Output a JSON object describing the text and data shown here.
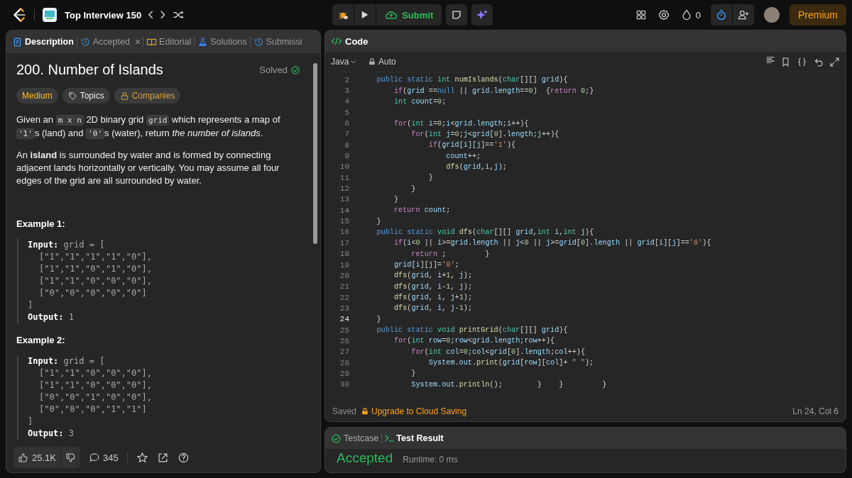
{
  "topbar": {
    "list_title": "Top Interview 150",
    "submit": "Submit",
    "streak": "0",
    "premium": "Premium"
  },
  "description": {
    "tabs": [
      {
        "kind": "doc",
        "label": "Description",
        "selected": true
      },
      {
        "kind": "history",
        "label": "Accepted",
        "selected": false,
        "close": "×"
      },
      {
        "kind": "book",
        "label": "Editorial",
        "selected": false
      },
      {
        "kind": "flask",
        "label": "Solutions",
        "selected": false
      },
      {
        "kind": "history",
        "label": "Submissi",
        "selected": false
      }
    ],
    "title": "200. Number of Islands",
    "status": "Solved",
    "tags": [
      {
        "kind": "difficulty",
        "label": "Medium"
      },
      {
        "kind": "tag",
        "label": "Topics"
      },
      {
        "kind": "lock",
        "label": "Companies"
      }
    ],
    "paragraphs": [
      [
        {
          "kind": "text",
          "text": "Given an "
        },
        {
          "kind": "code",
          "text": "m x n"
        },
        {
          "kind": "text",
          "text": " 2D binary grid "
        },
        {
          "kind": "code",
          "text": "grid"
        },
        {
          "kind": "text",
          "text": " which represents a map of "
        },
        {
          "kind": "code",
          "text": "'1'"
        },
        {
          "kind": "text",
          "text": "s (land) and "
        },
        {
          "kind": "code",
          "text": "'0'"
        },
        {
          "kind": "text",
          "text": "s (water), return *the number of islands*."
        }
      ],
      [
        {
          "kind": "text",
          "text": "An **island** is surrounded by water and is formed by connecting adjacent lands horizontally or vertically. You may assume all four edges of the grid are all surrounded by water."
        }
      ]
    ],
    "examples": [
      {
        "title": "Example 1:",
        "input_label": "Input:",
        "input_head": "grid = [",
        "rows": [
          "[\"1\",\"1\",\"1\",\"1\",\"0\"],",
          "[\"1\",\"1\",\"0\",\"1\",\"0\"],",
          "[\"1\",\"1\",\"0\",\"0\",\"0\"],",
          "[\"0\",\"0\",\"0\",\"0\",\"0\"]"
        ],
        "input_tail": "]",
        "output_label": "Output:",
        "output": "1"
      },
      {
        "title": "Example 2:",
        "input_label": "Input:",
        "input_head": "grid = [",
        "rows": [
          "[\"1\",\"1\",\"0\",\"0\",\"0\"],",
          "[\"1\",\"1\",\"0\",\"0\",\"0\"],",
          "[\"0\",\"0\",\"1\",\"0\",\"0\"],",
          "[\"0\",\"0\",\"0\",\"1\",\"1\"]"
        ],
        "input_tail": "]",
        "output_label": "Output:",
        "output": "3"
      }
    ],
    "footer": {
      "likes": "25.1K",
      "comments": "345"
    }
  },
  "code": {
    "title": "Code",
    "language": "Java",
    "mode": "Auto",
    "lines": [
      {
        "number": "2",
        "current": false,
        "tokens": [
          {
            "kind": "m",
            "text": "    public static "
          },
          {
            "kind": "t",
            "text": "int "
          },
          {
            "kind": "f",
            "text": "numIslands"
          },
          {
            "kind": "p",
            "text": "("
          },
          {
            "kind": "t",
            "text": "char"
          },
          {
            "kind": "p",
            "text": "[][] "
          },
          {
            "kind": "v",
            "text": "grid"
          },
          {
            "kind": "p",
            "text": "){"
          }
        ]
      },
      {
        "number": "3",
        "current": false,
        "tokens": [
          {
            "kind": "k",
            "text": "        if"
          },
          {
            "kind": "p",
            "text": "("
          },
          {
            "kind": "v",
            "text": "grid "
          },
          {
            "kind": "p",
            "text": "=="
          },
          {
            "kind": "m",
            "text": "null"
          },
          {
            "kind": "p",
            "text": " || "
          },
          {
            "kind": "v",
            "text": "grid.length"
          },
          {
            "kind": "p",
            "text": "=="
          },
          {
            "kind": "n",
            "text": "0"
          },
          {
            "kind": "p",
            "text": ")  {"
          },
          {
            "kind": "k",
            "text": "return "
          },
          {
            "kind": "n",
            "text": "0"
          },
          {
            "kind": "p",
            "text": ";}"
          }
        ]
      },
      {
        "number": "4",
        "current": false,
        "tokens": [
          {
            "kind": "t",
            "text": "        int "
          },
          {
            "kind": "v",
            "text": "count"
          },
          {
            "kind": "p",
            "text": "="
          },
          {
            "kind": "n",
            "text": "0"
          },
          {
            "kind": "p",
            "text": ";"
          }
        ]
      },
      {
        "number": "5",
        "current": false
      },
      {
        "number": "6",
        "current": false,
        "tokens": [
          {
            "kind": "k",
            "text": "        for"
          },
          {
            "kind": "p",
            "text": "("
          },
          {
            "kind": "t",
            "text": "int "
          },
          {
            "kind": "v",
            "text": "i"
          },
          {
            "kind": "p",
            "text": "="
          },
          {
            "kind": "n",
            "text": "0"
          },
          {
            "kind": "p",
            "text": ";"
          },
          {
            "kind": "v",
            "text": "i"
          },
          {
            "kind": "p",
            "text": "<"
          },
          {
            "kind": "v",
            "text": "grid.length"
          },
          {
            "kind": "p",
            "text": ";"
          },
          {
            "kind": "v",
            "text": "i"
          },
          {
            "kind": "p",
            "text": "++){"
          }
        ]
      },
      {
        "number": "7",
        "current": false,
        "tokens": [
          {
            "kind": "k",
            "text": "            for"
          },
          {
            "kind": "p",
            "text": "("
          },
          {
            "kind": "t",
            "text": "int "
          },
          {
            "kind": "v",
            "text": "j"
          },
          {
            "kind": "p",
            "text": "="
          },
          {
            "kind": "n",
            "text": "0"
          },
          {
            "kind": "p",
            "text": ";"
          },
          {
            "kind": "v",
            "text": "j"
          },
          {
            "kind": "p",
            "text": "<"
          },
          {
            "kind": "v",
            "text": "grid"
          },
          {
            "kind": "p",
            "text": "["
          },
          {
            "kind": "n",
            "text": "0"
          },
          {
            "kind": "p",
            "text": "]."
          },
          {
            "kind": "v",
            "text": "length"
          },
          {
            "kind": "p",
            "text": ";"
          },
          {
            "kind": "v",
            "text": "j"
          },
          {
            "kind": "p",
            "text": "++){"
          }
        ]
      },
      {
        "number": "8",
        "current": false,
        "tokens": [
          {
            "kind": "k",
            "text": "                if"
          },
          {
            "kind": "p",
            "text": "("
          },
          {
            "kind": "v",
            "text": "grid"
          },
          {
            "kind": "p",
            "text": "["
          },
          {
            "kind": "v",
            "text": "i"
          },
          {
            "kind": "p",
            "text": "]["
          },
          {
            "kind": "v",
            "text": "j"
          },
          {
            "kind": "p",
            "text": "]=="
          },
          {
            "kind": "s",
            "text": "'1'"
          },
          {
            "kind": "p",
            "text": "){"
          }
        ]
      },
      {
        "number": "9",
        "current": false,
        "tokens": [
          {
            "kind": "v",
            "text": "                    count"
          },
          {
            "kind": "p",
            "text": "++;"
          }
        ]
      },
      {
        "number": "10",
        "current": false,
        "tokens": [
          {
            "kind": "f",
            "text": "                    dfs"
          },
          {
            "kind": "p",
            "text": "("
          },
          {
            "kind": "v",
            "text": "grid"
          },
          {
            "kind": "p",
            "text": ","
          },
          {
            "kind": "v",
            "text": "i"
          },
          {
            "kind": "p",
            "text": ","
          },
          {
            "kind": "v",
            "text": "j"
          },
          {
            "kind": "p",
            "text": ");"
          }
        ]
      },
      {
        "number": "11",
        "current": false,
        "tokens": [
          {
            "kind": "p",
            "text": "                }"
          }
        ]
      },
      {
        "number": "12",
        "current": false,
        "tokens": [
          {
            "kind": "p",
            "text": "            }"
          }
        ]
      },
      {
        "number": "13",
        "current": false,
        "tokens": [
          {
            "kind": "p",
            "text": "        }"
          }
        ]
      },
      {
        "number": "14",
        "current": false,
        "tokens": [
          {
            "kind": "k",
            "text": "        return "
          },
          {
            "kind": "v",
            "text": "count"
          },
          {
            "kind": "p",
            "text": ";"
          }
        ]
      },
      {
        "number": "15",
        "current": false,
        "tokens": [
          {
            "kind": "p",
            "text": "    }"
          }
        ]
      },
      {
        "number": "16",
        "current": false,
        "tokens": [
          {
            "kind": "m",
            "text": "    public static "
          },
          {
            "kind": "t",
            "text": "void "
          },
          {
            "kind": "f",
            "text": "dfs"
          },
          {
            "kind": "p",
            "text": "("
          },
          {
            "kind": "t",
            "text": "char"
          },
          {
            "kind": "p",
            "text": "[][] "
          },
          {
            "kind": "v",
            "text": "grid"
          },
          {
            "kind": "p",
            "text": ","
          },
          {
            "kind": "t",
            "text": "int "
          },
          {
            "kind": "v",
            "text": "i"
          },
          {
            "kind": "p",
            "text": ","
          },
          {
            "kind": "t",
            "text": "int "
          },
          {
            "kind": "v",
            "text": "j"
          },
          {
            "kind": "p",
            "text": "){"
          }
        ]
      },
      {
        "number": "17",
        "current": false,
        "tokens": [
          {
            "kind": "k",
            "text": "        if"
          },
          {
            "kind": "p",
            "text": "("
          },
          {
            "kind": "v",
            "text": "i"
          },
          {
            "kind": "p",
            "text": "<"
          },
          {
            "kind": "n",
            "text": "0"
          },
          {
            "kind": "p",
            "text": " || "
          },
          {
            "kind": "v",
            "text": "i"
          },
          {
            "kind": "p",
            "text": ">="
          },
          {
            "kind": "v",
            "text": "grid.length"
          },
          {
            "kind": "p",
            "text": " || "
          },
          {
            "kind": "v",
            "text": "j"
          },
          {
            "kind": "p",
            "text": "<"
          },
          {
            "kind": "n",
            "text": "0"
          },
          {
            "kind": "p",
            "text": " || "
          },
          {
            "kind": "v",
            "text": "j"
          },
          {
            "kind": "p",
            "text": ">="
          },
          {
            "kind": "v",
            "text": "grid"
          },
          {
            "kind": "p",
            "text": "["
          },
          {
            "kind": "n",
            "text": "0"
          },
          {
            "kind": "p",
            "text": "]."
          },
          {
            "kind": "v",
            "text": "length"
          },
          {
            "kind": "p",
            "text": " || "
          },
          {
            "kind": "v",
            "text": "grid"
          },
          {
            "kind": "p",
            "text": "["
          },
          {
            "kind": "v",
            "text": "i"
          },
          {
            "kind": "p",
            "text": "]["
          },
          {
            "kind": "v",
            "text": "j"
          },
          {
            "kind": "p",
            "text": "]=="
          },
          {
            "kind": "s",
            "text": "'0'"
          },
          {
            "kind": "p",
            "text": "){"
          }
        ]
      },
      {
        "number": "18",
        "current": false,
        "tokens": [
          {
            "kind": "k",
            "text": "            return "
          },
          {
            "kind": "p",
            "text": ";         }"
          }
        ]
      },
      {
        "number": "19",
        "current": false,
        "tokens": [
          {
            "kind": "v",
            "text": "        grid"
          },
          {
            "kind": "p",
            "text": "["
          },
          {
            "kind": "v",
            "text": "i"
          },
          {
            "kind": "p",
            "text": "]["
          },
          {
            "kind": "v",
            "text": "j"
          },
          {
            "kind": "p",
            "text": "]="
          },
          {
            "kind": "s",
            "text": "'0'"
          },
          {
            "kind": "p",
            "text": ";"
          }
        ]
      },
      {
        "number": "20",
        "current": false,
        "tokens": [
          {
            "kind": "f",
            "text": "        dfs"
          },
          {
            "kind": "p",
            "text": "("
          },
          {
            "kind": "v",
            "text": "grid"
          },
          {
            "kind": "p",
            "text": ", "
          },
          {
            "kind": "v",
            "text": "i"
          },
          {
            "kind": "p",
            "text": "+"
          },
          {
            "kind": "n",
            "text": "1"
          },
          {
            "kind": "p",
            "text": ", "
          },
          {
            "kind": "v",
            "text": "j"
          },
          {
            "kind": "p",
            "text": ");"
          }
        ]
      },
      {
        "number": "21",
        "current": false,
        "tokens": [
          {
            "kind": "f",
            "text": "        dfs"
          },
          {
            "kind": "p",
            "text": "("
          },
          {
            "kind": "v",
            "text": "grid"
          },
          {
            "kind": "p",
            "text": ", "
          },
          {
            "kind": "v",
            "text": "i"
          },
          {
            "kind": "p",
            "text": "-"
          },
          {
            "kind": "n",
            "text": "1"
          },
          {
            "kind": "p",
            "text": ", "
          },
          {
            "kind": "v",
            "text": "j"
          },
          {
            "kind": "p",
            "text": ");"
          }
        ]
      },
      {
        "number": "22",
        "current": false,
        "tokens": [
          {
            "kind": "f",
            "text": "        dfs"
          },
          {
            "kind": "p",
            "text": "("
          },
          {
            "kind": "v",
            "text": "grid"
          },
          {
            "kind": "p",
            "text": ", "
          },
          {
            "kind": "v",
            "text": "i"
          },
          {
            "kind": "p",
            "text": ", "
          },
          {
            "kind": "v",
            "text": "j"
          },
          {
            "kind": "p",
            "text": "+"
          },
          {
            "kind": "n",
            "text": "1"
          },
          {
            "kind": "p",
            "text": ");"
          }
        ]
      },
      {
        "number": "23",
        "current": false,
        "tokens": [
          {
            "kind": "f",
            "text": "        dfs"
          },
          {
            "kind": "p",
            "text": "("
          },
          {
            "kind": "v",
            "text": "grid"
          },
          {
            "kind": "p",
            "text": ", "
          },
          {
            "kind": "v",
            "text": "i"
          },
          {
            "kind": "p",
            "text": ", "
          },
          {
            "kind": "v",
            "text": "j"
          },
          {
            "kind": "p",
            "text": "-"
          },
          {
            "kind": "n",
            "text": "1"
          },
          {
            "kind": "p",
            "text": ");"
          }
        ]
      },
      {
        "number": "24",
        "current": true,
        "tokens": [
          {
            "kind": "p",
            "text": "    }"
          }
        ]
      },
      {
        "number": "25",
        "current": false,
        "tokens": [
          {
            "kind": "m",
            "text": "    public static "
          },
          {
            "kind": "t",
            "text": "void "
          },
          {
            "kind": "f",
            "text": "printGrid"
          },
          {
            "kind": "p",
            "text": "("
          },
          {
            "kind": "t",
            "text": "char"
          },
          {
            "kind": "p",
            "text": "[][] "
          },
          {
            "kind": "v",
            "text": "grid"
          },
          {
            "kind": "p",
            "text": "){"
          }
        ]
      },
      {
        "number": "26",
        "current": false,
        "tokens": [
          {
            "kind": "k",
            "text": "        for"
          },
          {
            "kind": "p",
            "text": "("
          },
          {
            "kind": "t",
            "text": "int "
          },
          {
            "kind": "v",
            "text": "row"
          },
          {
            "kind": "p",
            "text": "="
          },
          {
            "kind": "n",
            "text": "0"
          },
          {
            "kind": "p",
            "text": ";"
          },
          {
            "kind": "v",
            "text": "row"
          },
          {
            "kind": "p",
            "text": "<"
          },
          {
            "kind": "v",
            "text": "grid.length"
          },
          {
            "kind": "p",
            "text": ";"
          },
          {
            "kind": "v",
            "text": "row"
          },
          {
            "kind": "p",
            "text": "++){"
          }
        ]
      },
      {
        "number": "27",
        "current": false,
        "tokens": [
          {
            "kind": "k",
            "text": "            for"
          },
          {
            "kind": "p",
            "text": "("
          },
          {
            "kind": "t",
            "text": "int "
          },
          {
            "kind": "v",
            "text": "col"
          },
          {
            "kind": "p",
            "text": "="
          },
          {
            "kind": "n",
            "text": "0"
          },
          {
            "kind": "p",
            "text": ";"
          },
          {
            "kind": "v",
            "text": "col"
          },
          {
            "kind": "p",
            "text": "<"
          },
          {
            "kind": "v",
            "text": "grid"
          },
          {
            "kind": "p",
            "text": "["
          },
          {
            "kind": "n",
            "text": "0"
          },
          {
            "kind": "p",
            "text": "]."
          },
          {
            "kind": "v",
            "text": "length"
          },
          {
            "kind": "p",
            "text": ";"
          },
          {
            "kind": "v",
            "text": "col"
          },
          {
            "kind": "p",
            "text": "++){"
          }
        ]
      },
      {
        "number": "28",
        "current": false,
        "tokens": [
          {
            "kind": "v",
            "text": "                System.out"
          },
          {
            "kind": "p",
            "text": "."
          },
          {
            "kind": "f",
            "text": "print"
          },
          {
            "kind": "p",
            "text": "("
          },
          {
            "kind": "v",
            "text": "grid"
          },
          {
            "kind": "p",
            "text": "["
          },
          {
            "kind": "v",
            "text": "row"
          },
          {
            "kind": "p",
            "text": "]["
          },
          {
            "kind": "v",
            "text": "col"
          },
          {
            "kind": "p",
            "text": "]+ "
          },
          {
            "kind": "s",
            "text": "\" \""
          },
          {
            "kind": "p",
            "text": ");"
          }
        ]
      },
      {
        "number": "29",
        "current": false,
        "tokens": [
          {
            "kind": "p",
            "text": "            }"
          }
        ]
      },
      {
        "number": "30",
        "current": false,
        "tokens": [
          {
            "kind": "v",
            "text": "            System.out"
          },
          {
            "kind": "p",
            "text": "."
          },
          {
            "kind": "f",
            "text": "println"
          },
          {
            "kind": "p",
            "text": "();        }    }         }"
          }
        ]
      }
    ],
    "saved": "Saved",
    "upgrade": "Upgrade to Cloud Saving",
    "position": "Ln 24, Col 6"
  },
  "tests": {
    "tabs": [
      {
        "kind": "check",
        "label": "Testcase",
        "selected": false
      },
      {
        "kind": "terminal",
        "label": "Test Result",
        "selected": true
      }
    ],
    "verdict": "Accepted",
    "runtime": "Runtime: 0 ms"
  }
}
